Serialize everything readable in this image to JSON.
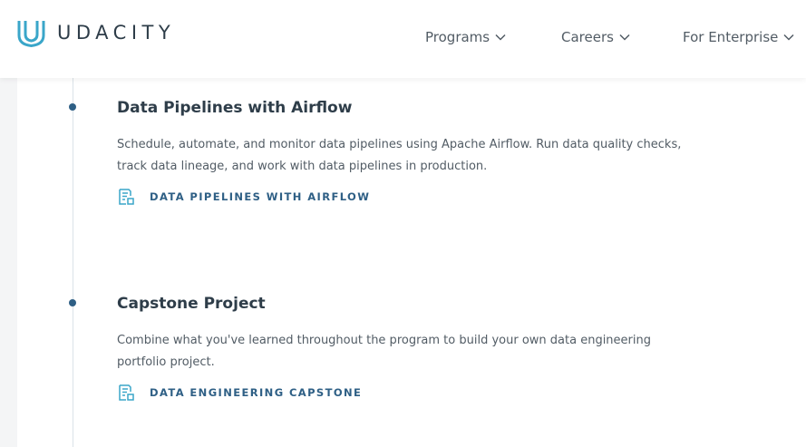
{
  "header": {
    "brand": "UDACITY",
    "logo_icon": "udacity-u-logo",
    "nav": [
      {
        "label": "Programs",
        "icon": "chevron-down"
      },
      {
        "label": "Careers",
        "icon": "chevron-down"
      },
      {
        "label": "For Enterprise",
        "icon": "chevron-down"
      }
    ]
  },
  "modules": [
    {
      "title": "Data Pipelines with Airflow",
      "description": "Schedule, automate, and monitor data pipelines using Apache Airflow. Run data quality checks, track data lineage, and work with data pipelines in production.",
      "link_label": "DATA PIPELINES WITH AIRFLOW",
      "link_icon": "lesson-icon"
    },
    {
      "title": "Capstone Project",
      "description": "Combine what you've learned throughout the program to build your own data engineering portfolio project.",
      "link_label": "DATA ENGINEERING CAPSTONE",
      "link_icon": "lesson-icon"
    }
  ],
  "colors": {
    "brand_blue": "#2e5f85",
    "logo_blue": "#3aa6c9",
    "text_dark": "#2e3d49",
    "text_body": "#525c65"
  }
}
